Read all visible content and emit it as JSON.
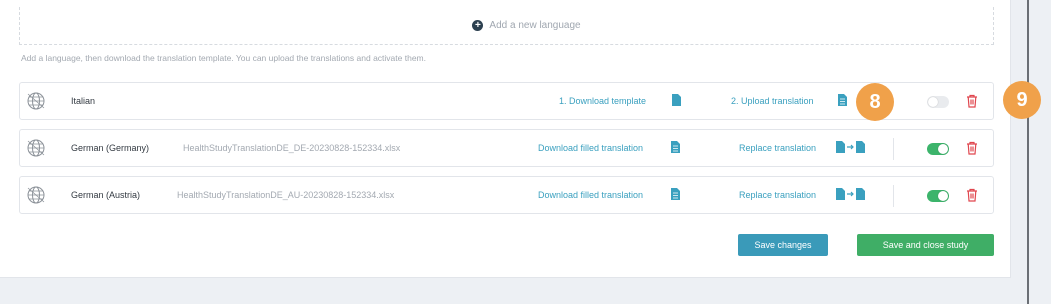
{
  "add_language": {
    "label": "Add a new language",
    "icon": "plus-circle-icon"
  },
  "hint": "Add a language, then download the translation template. You can upload the translations and activate them.",
  "rows": [
    {
      "language": "Italian",
      "file": "",
      "download_label": "1. Download template",
      "upload_label": "2. Upload translation",
      "enabled": false
    },
    {
      "language": "German (Germany)",
      "file": "HealthStudyTranslationDE_DE-20230828-152334.xlsx",
      "download_label": "Download filled translation",
      "upload_label": "Replace translation",
      "enabled": true
    },
    {
      "language": "German (Austria)",
      "file": "HealthStudyTranslationDE_AU-20230828-152334.xlsx",
      "download_label": "Download filled translation",
      "upload_label": "Replace translation",
      "enabled": true
    }
  ],
  "badges": [
    "8",
    "9"
  ],
  "buttons": {
    "save": "Save changes",
    "save_close": "Save and close study"
  },
  "colors": {
    "link": "#3aa0bf",
    "toggle_on": "#3cb46b",
    "badge": "#f0a14a",
    "delete": "#e0464e",
    "save_button": "#3a9ab9",
    "close_button": "#3fae66"
  }
}
